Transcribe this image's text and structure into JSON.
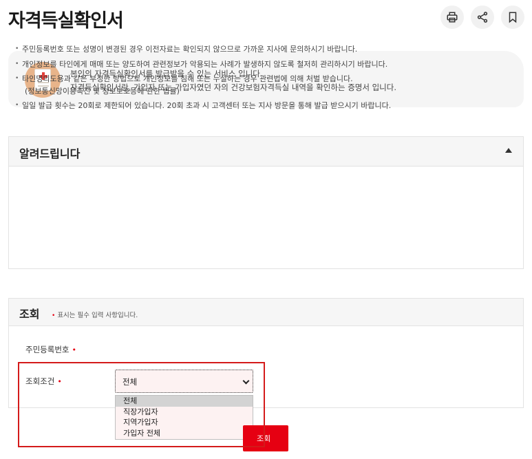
{
  "page": {
    "title": "자격득실확인서"
  },
  "toolbar": {
    "print_icon": "printer-icon",
    "share_icon": "share-icon",
    "bookmark_icon": "bookmark-icon"
  },
  "intro": {
    "icon": "medical-document-icon",
    "line1": "본인의 자격득실확인서를 발급받을 수 있는 서비스 입니다.",
    "line2": "자격득실확인서란, 가입자 또는 가입자였던 자의 건강보험자격득실 내역을 확인하는 증명서 입니다."
  },
  "notice": {
    "title": "알려드립니다",
    "toggle_icon": "collapse-up-icon",
    "items": [
      "주민등록번호 또는 성명이 변경된 경우 이전자료는 확인되지 않으므로 가까운 지사에 문의하시기 바랍니다.",
      "개인정보를 타인에게 매매 또는 양도하여 관련정보가 악용되는 사례가 발생하지 않도록 철저히 관리하시기 바랍니다.",
      "타인명의도용과 같은 부정한 방법으로 개인정보를 침해 또는 누설하는 경우 관련법에 의해 처벌 받습니다.",
      "(정보통신망이용촉진 및 정보보호등에 관한 법률)",
      "일일 발급 횟수는 20회로 제한되어 있습니다. 20회 초과 시 고객센터 또는 지사 방문을 통해 발급 받으시기 바랍니다."
    ]
  },
  "search": {
    "title": "조회",
    "required_mark": "•",
    "required_note": "표시는 필수 입력 사항입니다.",
    "rrn_label": "주민등록번호",
    "condition_label": "조회조건",
    "condition_value": "전체",
    "options": [
      "전체",
      "직장가입자",
      "지역가입자",
      "가입자 전체"
    ],
    "submit_label": "조회"
  },
  "colors": {
    "accent": "#e60012",
    "highlight_frame": "#d41a1a",
    "select_bg": "#fdf2f2"
  }
}
